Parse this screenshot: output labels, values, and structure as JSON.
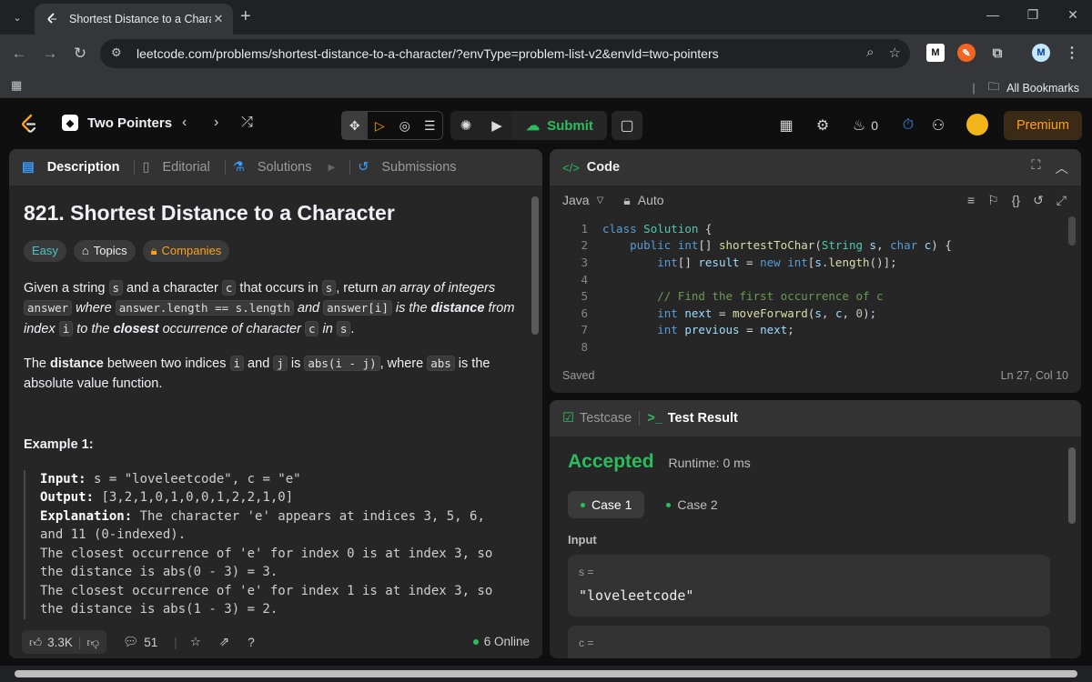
{
  "browser": {
    "tab_title": "Shortest Distance to a Character",
    "url": "leetcode.com/problems/shortest-distance-to-a-character/?envType=problem-list-v2&envId=two-pointers",
    "bookmarks_label": "All Bookmarks",
    "ext_m": "M",
    "profile": "M"
  },
  "header": {
    "list_name": "Two Pointers",
    "submit_label": "Submit",
    "streak_count": "0",
    "premium_label": "Premium"
  },
  "left": {
    "tabs": [
      "Description",
      "Editorial",
      "Solutions",
      "Submissions"
    ],
    "title": "821. Shortest Distance to a Character",
    "chips": {
      "difficulty": "Easy",
      "topics": "Topics",
      "companies": "Companies"
    },
    "p1": {
      "a": "Given a string ",
      "s1": "s",
      "b": " and a character ",
      "c1": "c",
      "c": " that occurs in ",
      "s2": "s",
      "d": ", return ",
      "e": "an array of integers",
      "ans": "answer",
      "f": " where ",
      "len": "answer.length == s.length",
      "g": " and ",
      "ai": "answer[i]",
      "h": " is the ",
      "dist": "distance",
      "k": " from index ",
      "i1": "i",
      "l": " to the ",
      "closest": "closest",
      "m": " occurrence of character ",
      "c2": "c",
      "n": " in ",
      "s3": "s",
      "o": "."
    },
    "p2": {
      "a": "The ",
      "dist": "distance",
      "b": " between two indices ",
      "i": "i",
      "c": " and ",
      "j": "j",
      "d": " is ",
      "abs1": "abs(i - j)",
      "e": ", where ",
      "abs2": "abs",
      "f": " is the absolute value function."
    },
    "example_title": "Example 1:",
    "example": {
      "in_k": "Input:",
      "in_v": " s = \"loveleetcode\", c = \"e\"",
      "out_k": "Output:",
      "out_v": " [3,2,1,0,1,0,0,1,2,2,1,0]",
      "exp_k": "Explanation:",
      "exp_v": " The character 'e' appears at indices 3, 5, 6,",
      "l4": "and 11 (0-indexed).",
      "l5": "The closest occurrence of 'e' for index 0 is at index 3, so",
      "l6": "the distance is abs(0 - 3) = 3.",
      "l7": "The closest occurrence of 'e' for index 1 is at index 3, so",
      "l8": "the distance is abs(1 - 3) = 2."
    },
    "footer": {
      "likes": "3.3K",
      "comments": "51",
      "online": "6 Online"
    }
  },
  "code": {
    "title": "Code",
    "language": "Java",
    "mode": "Auto",
    "lines": [
      "1",
      "2",
      "3",
      "4",
      "5",
      "6",
      "7",
      "8"
    ],
    "status": "Saved",
    "cursor": "Ln 27, Col 10"
  },
  "result": {
    "tabs": [
      "Testcase",
      "Test Result"
    ],
    "status": "Accepted",
    "runtime": "Runtime: 0 ms",
    "cases": [
      "Case 1",
      "Case 2"
    ],
    "input_label": "Input",
    "var1_name": "s =",
    "var1_value": "\"loveleetcode\"",
    "var2_name": "c ="
  },
  "colors": {
    "accent_orange": "#ffa116",
    "accepted_green": "#2cbb5d",
    "easy_teal": "#46c6c2"
  }
}
